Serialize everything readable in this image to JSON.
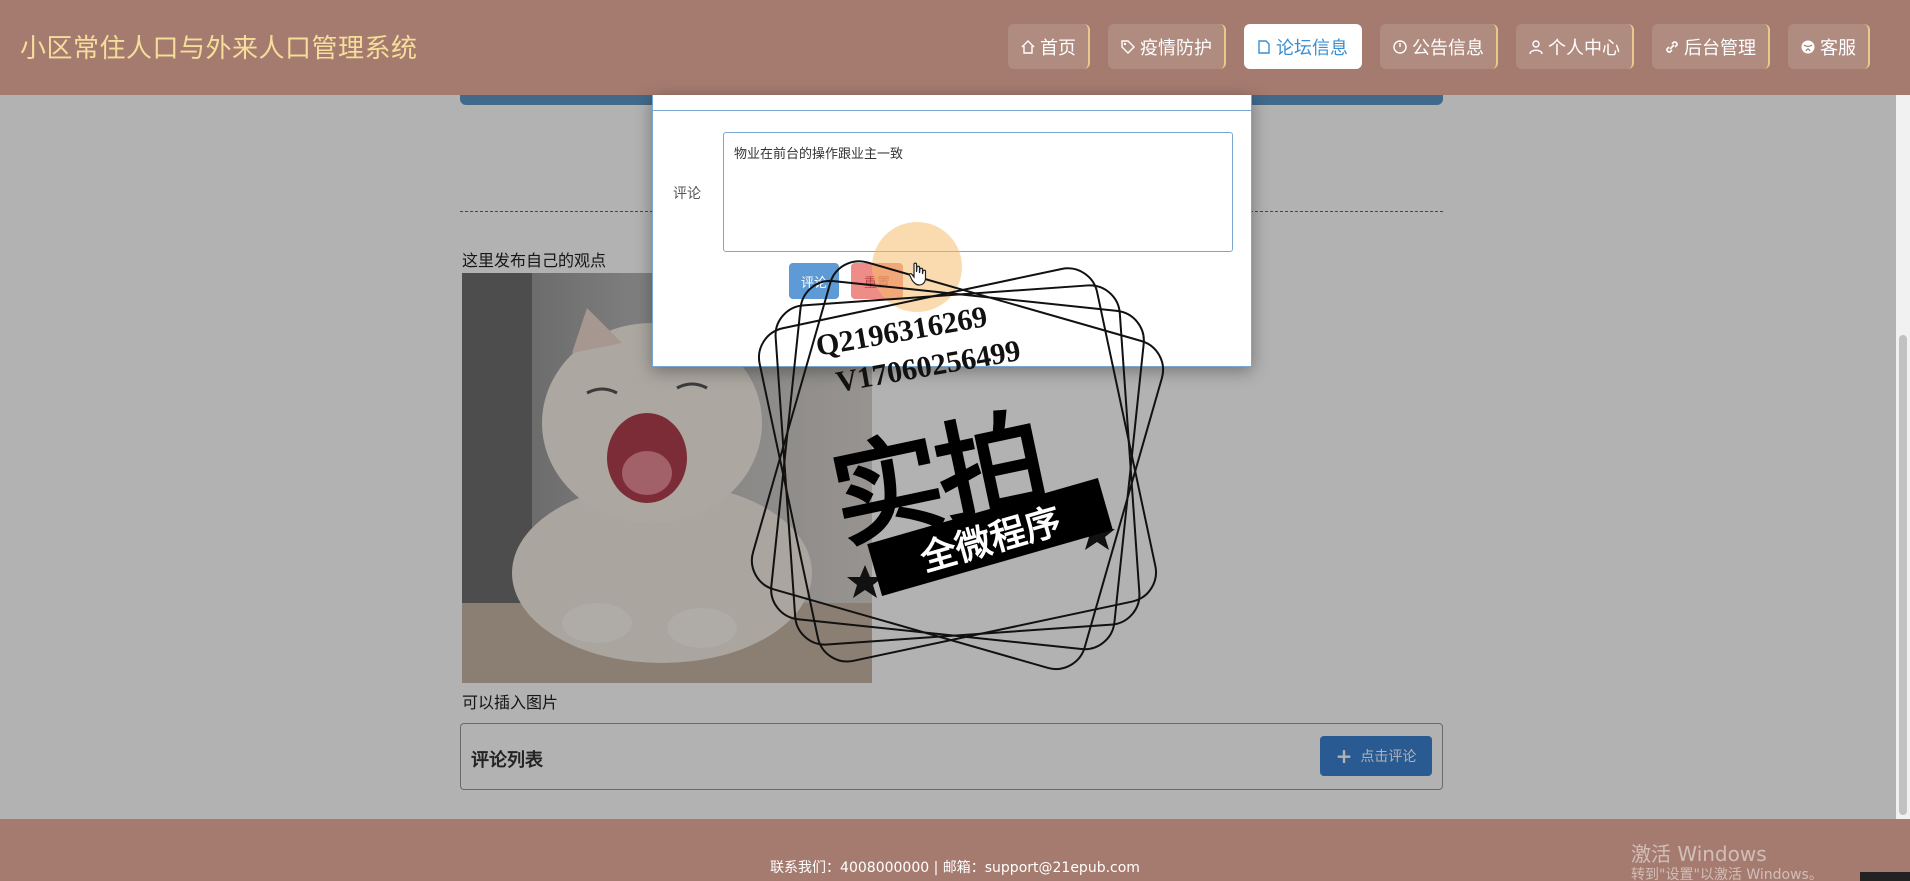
{
  "header": {
    "title": "小区常住人口与外来人口管理系统",
    "nav": [
      {
        "label": "首页",
        "icon": "home-icon"
      },
      {
        "label": "疫情防护",
        "icon": "tag-icon"
      },
      {
        "label": "论坛信息",
        "icon": "document-icon",
        "active": true
      },
      {
        "label": "公告信息",
        "icon": "clock-icon"
      },
      {
        "label": "个人中心",
        "icon": "user-icon"
      },
      {
        "label": "后台管理",
        "icon": "link-icon"
      },
      {
        "label": "客服",
        "icon": "globe-icon"
      }
    ]
  },
  "post": {
    "text": "这里发布自己的观点",
    "caption": "可以插入图片"
  },
  "comments": {
    "title": "评论列表",
    "add_button": "点击评论"
  },
  "modal": {
    "label": "评论",
    "textarea_value": "物业在前台的操作跟业主一致",
    "submit": "评论",
    "reset": "重置"
  },
  "footer": {
    "text": "联系我们：4008000000 | 邮箱：support@21epub.com"
  },
  "watermark": {
    "phone1": "Q2196316269",
    "phone2": "V17060256499",
    "main": "实拍",
    "ribbon": "全微程序"
  },
  "windows": {
    "activate": "激活 Windows",
    "sub": "转到\"设置\"以激活 Windows。"
  },
  "colors": {
    "header_bg": "#a57b6f",
    "brand": "#f5dd9a",
    "accent_blue": "#3b82d0"
  }
}
